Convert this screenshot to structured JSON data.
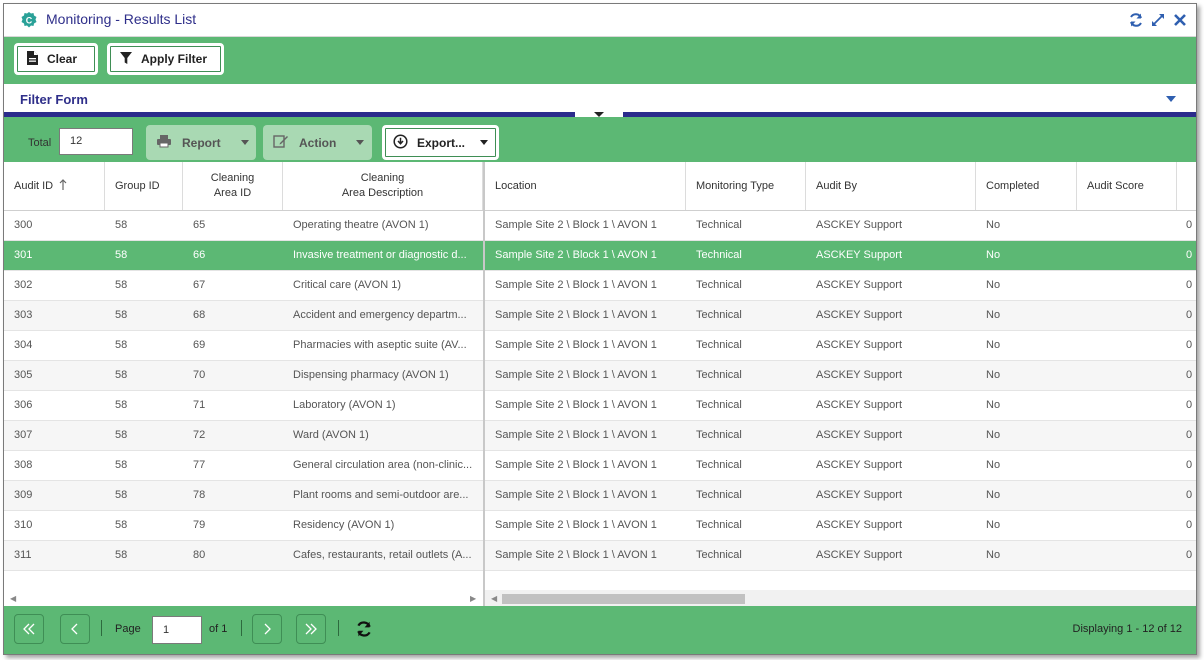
{
  "window": {
    "title": "Monitoring - Results List",
    "tools": [
      "refresh-icon",
      "maximize-icon",
      "close-icon"
    ]
  },
  "toolbar": {
    "clear_label": "Clear",
    "apply_filter_label": "Apply Filter"
  },
  "filter_form": {
    "title": "Filter Form"
  },
  "grid_toolbar": {
    "total_label": "Total",
    "total_value": "12",
    "report_label": "Report",
    "action_label": "Action",
    "export_label": "Export..."
  },
  "columns": [
    {
      "label": "Audit ID",
      "sorted": "asc"
    },
    {
      "label": "Group ID"
    },
    {
      "label": "Cleaning\nArea ID"
    },
    {
      "label": "Cleaning\nArea Description"
    },
    {
      "label": "Location"
    },
    {
      "label": "Monitoring Type"
    },
    {
      "label": "Audit By"
    },
    {
      "label": "Completed"
    },
    {
      "label": "Audit Score"
    }
  ],
  "header_lines": {
    "area_id_1": "Cleaning",
    "area_id_2": "Area ID",
    "area_desc_1": "Cleaning",
    "area_desc_2": "Area Description"
  },
  "selected_row_index": 1,
  "rows": [
    {
      "audit_id": "300",
      "group_id": "58",
      "area_id": "65",
      "area_desc": "Operating theatre (AVON 1)",
      "location": "Sample Site 2 \\ Block 1 \\ AVON 1",
      "type": "Technical",
      "audit_by": "ASCKEY Support",
      "completed": "No",
      "score": "0"
    },
    {
      "audit_id": "301",
      "group_id": "58",
      "area_id": "66",
      "area_desc": "Invasive treatment or diagnostic d...",
      "location": "Sample Site 2 \\ Block 1 \\ AVON 1",
      "type": "Technical",
      "audit_by": "ASCKEY Support",
      "completed": "No",
      "score": "0"
    },
    {
      "audit_id": "302",
      "group_id": "58",
      "area_id": "67",
      "area_desc": "Critical care (AVON 1)",
      "location": "Sample Site 2 \\ Block 1 \\ AVON 1",
      "type": "Technical",
      "audit_by": "ASCKEY Support",
      "completed": "No",
      "score": "0"
    },
    {
      "audit_id": "303",
      "group_id": "58",
      "area_id": "68",
      "area_desc": "Accident and emergency departm...",
      "location": "Sample Site 2 \\ Block 1 \\ AVON 1",
      "type": "Technical",
      "audit_by": "ASCKEY Support",
      "completed": "No",
      "score": "0"
    },
    {
      "audit_id": "304",
      "group_id": "58",
      "area_id": "69",
      "area_desc": "Pharmacies with aseptic suite (AV...",
      "location": "Sample Site 2 \\ Block 1 \\ AVON 1",
      "type": "Technical",
      "audit_by": "ASCKEY Support",
      "completed": "No",
      "score": "0"
    },
    {
      "audit_id": "305",
      "group_id": "58",
      "area_id": "70",
      "area_desc": "Dispensing pharmacy (AVON 1)",
      "location": "Sample Site 2 \\ Block 1 \\ AVON 1",
      "type": "Technical",
      "audit_by": "ASCKEY Support",
      "completed": "No",
      "score": "0"
    },
    {
      "audit_id": "306",
      "group_id": "58",
      "area_id": "71",
      "area_desc": "Laboratory (AVON 1)",
      "location": "Sample Site 2 \\ Block 1 \\ AVON 1",
      "type": "Technical",
      "audit_by": "ASCKEY Support",
      "completed": "No",
      "score": "0"
    },
    {
      "audit_id": "307",
      "group_id": "58",
      "area_id": "72",
      "area_desc": "Ward (AVON 1)",
      "location": "Sample Site 2 \\ Block 1 \\ AVON 1",
      "type": "Technical",
      "audit_by": "ASCKEY Support",
      "completed": "No",
      "score": "0"
    },
    {
      "audit_id": "308",
      "group_id": "58",
      "area_id": "77",
      "area_desc": "General circulation area (non-clinic...",
      "location": "Sample Site 2 \\ Block 1 \\ AVON 1",
      "type": "Technical",
      "audit_by": "ASCKEY Support",
      "completed": "No",
      "score": "0"
    },
    {
      "audit_id": "309",
      "group_id": "58",
      "area_id": "78",
      "area_desc": "Plant rooms and semi-outdoor are...",
      "location": "Sample Site 2 \\ Block 1 \\ AVON 1",
      "type": "Technical",
      "audit_by": "ASCKEY Support",
      "completed": "No",
      "score": "0"
    },
    {
      "audit_id": "310",
      "group_id": "58",
      "area_id": "79",
      "area_desc": "Residency (AVON 1)",
      "location": "Sample Site 2 \\ Block 1 \\ AVON 1",
      "type": "Technical",
      "audit_by": "ASCKEY Support",
      "completed": "No",
      "score": "0"
    },
    {
      "audit_id": "311",
      "group_id": "58",
      "area_id": "80",
      "area_desc": "Cafes, restaurants, retail outlets (A...",
      "location": "Sample Site 2 \\ Block 1 \\ AVON 1",
      "type": "Technical",
      "audit_by": "ASCKEY Support",
      "completed": "No",
      "score": "0"
    }
  ],
  "pager": {
    "page_label": "Page",
    "page_value": "1",
    "of_label": "of 1",
    "displaying": "Displaying 1 - 12 of 12"
  },
  "colors": {
    "accent_green": "#5cb874",
    "title_blue": "#2f2f8a",
    "splitter_navy": "#2b2b8c"
  }
}
